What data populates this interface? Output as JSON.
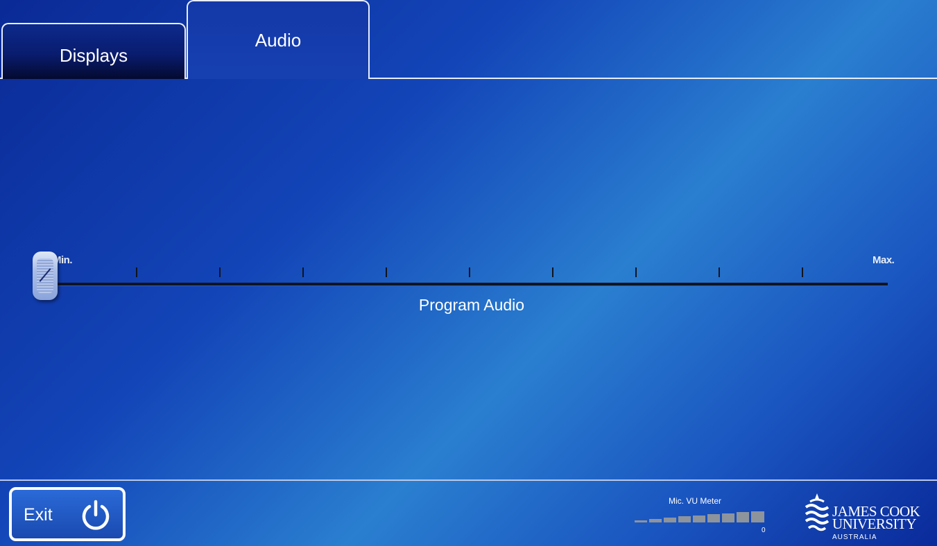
{
  "tabs": [
    {
      "label": "Displays",
      "active": false
    },
    {
      "label": "Audio",
      "active": true
    }
  ],
  "slider": {
    "min_label": "Min.",
    "max_label": "Max.",
    "label": "Program Audio",
    "value": 0
  },
  "footer": {
    "exit_label": "Exit",
    "power_icon": "power-icon"
  },
  "vu_meter": {
    "title": "Mic. VU Meter",
    "zero_label": "0",
    "level": 0
  },
  "logo": {
    "line1": "JAMES COOK",
    "line2": "UNIVERSITY",
    "line3": "AUSTRALIA"
  },
  "colors": {
    "background_dark": "#0a2a96",
    "background_light": "#2a7fd0",
    "meter_bar": "#8e949c"
  }
}
